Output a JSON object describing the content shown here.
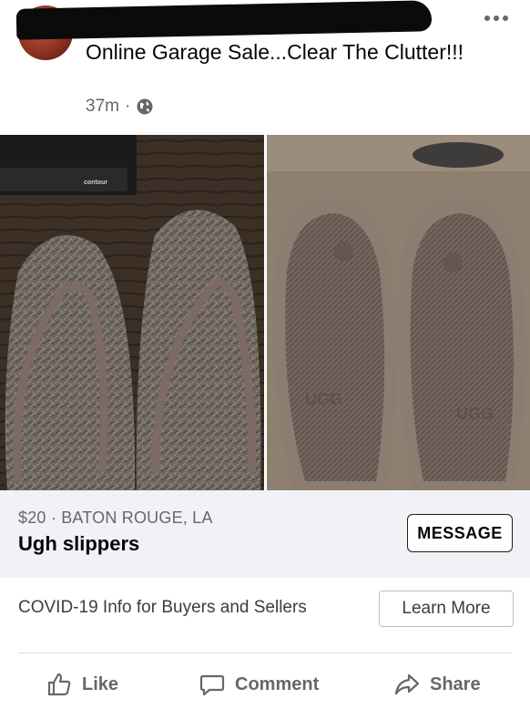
{
  "post": {
    "group_name": "Online Garage Sale...Clear The Clutter!!!",
    "time": "37m",
    "separator": "·",
    "visibility_icon": "globe-icon",
    "menu_icon": "more-dots-icon"
  },
  "photo_left": {
    "brand_text": "contour"
  },
  "photo_right": {
    "brand_text": "UGG"
  },
  "listing": {
    "price_location": "$20 · BATON ROUGE, LA",
    "title": "Ugh slippers",
    "message_label": "MESSAGE"
  },
  "covid": {
    "text": "COVID-19 Info for Buyers and Sellers",
    "learn_more_label": "Learn More"
  },
  "actions": {
    "like_label": "Like",
    "comment_label": "Comment",
    "share_label": "Share"
  },
  "colors": {
    "secondary_text": "#65676b",
    "listing_bg": "#f0f2f5"
  }
}
